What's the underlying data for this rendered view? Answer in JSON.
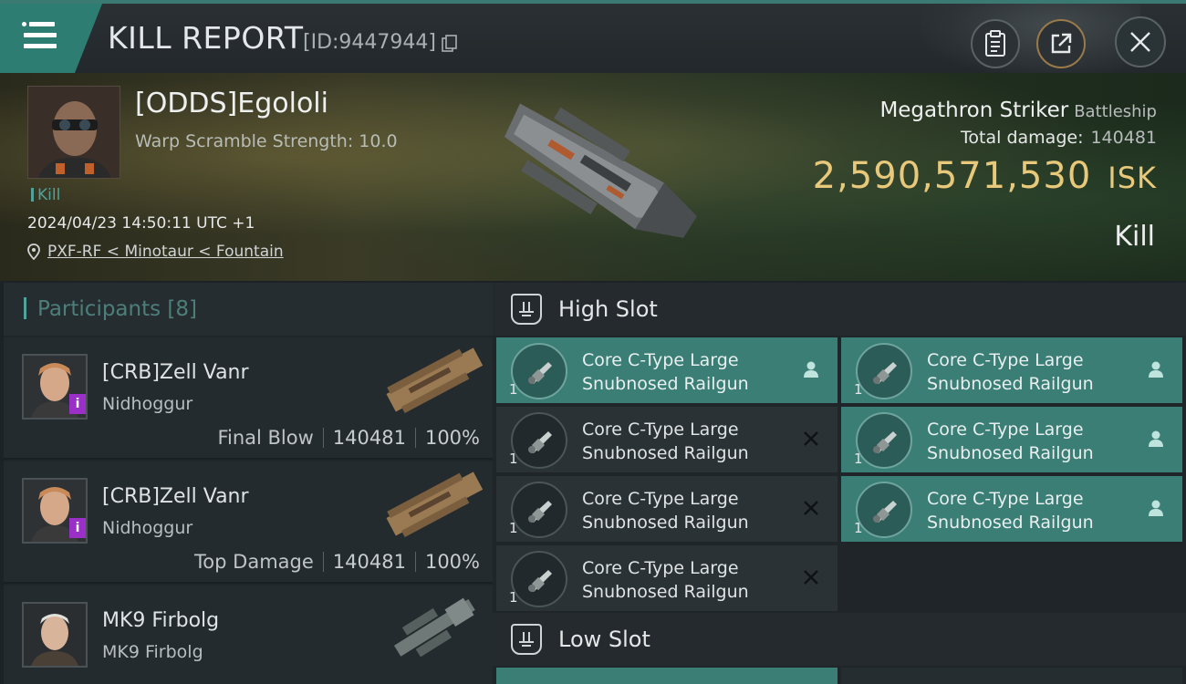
{
  "header": {
    "title": "KILL REPORT",
    "id_text": "[ID:9447944]"
  },
  "victim": {
    "name": "[ODDS]Egololi",
    "warp_scramble": "Warp Scramble Strength: 10.0",
    "tag": "Kill",
    "datetime": "2024/04/23 14:50:11 UTC +1",
    "location": "PXF-RF < Minotaur < Fountain",
    "ship": "Megathron Striker",
    "ship_class": "Battleship",
    "total_damage_label": "Total damage:",
    "total_damage": "140481",
    "isk_value": "2,590,571,530",
    "isk_unit": "ISK",
    "result": "Kill"
  },
  "participants": {
    "title": "Participants [8]",
    "rows": [
      {
        "name": "[CRB]Zell Vanr",
        "ship": "Nidhoggur",
        "label": "Final Blow",
        "damage": "140481",
        "percent": "100%"
      },
      {
        "name": "[CRB]Zell Vanr",
        "ship": "Nidhoggur",
        "label": "Top Damage",
        "damage": "140481",
        "percent": "100%"
      },
      {
        "name": "MK9 Firbolg",
        "ship": "MK9 Firbolg",
        "label": "",
        "damage": "",
        "percent": ""
      }
    ]
  },
  "slots": {
    "high_title": "High Slot",
    "low_title": "Low Slot",
    "high_modules": [
      {
        "line1": "Core C-Type Large",
        "line2": "Snubnosed Railgun",
        "qty": "1",
        "status": "user"
      },
      {
        "line1": "Core C-Type Large",
        "line2": "Snubnosed Railgun",
        "qty": "1",
        "status": "user"
      },
      {
        "line1": "Core C-Type Large",
        "line2": "Snubnosed Railgun",
        "qty": "1",
        "status": "destroyed"
      },
      {
        "line1": "Core C-Type Large",
        "line2": "Snubnosed Railgun",
        "qty": "1",
        "status": "user"
      },
      {
        "line1": "Core C-Type Large",
        "line2": "Snubnosed Railgun",
        "qty": "1",
        "status": "destroyed"
      },
      {
        "line1": "Core C-Type Large",
        "line2": "Snubnosed Railgun",
        "qty": "1",
        "status": "user"
      },
      {
        "line1": "Core C-Type Large",
        "line2": "Snubnosed Railgun",
        "qty": "1",
        "status": "destroyed"
      }
    ]
  },
  "colors": {
    "accent": "#3a7e76",
    "isk": "#e8c87a",
    "security": "#9b30c8"
  }
}
